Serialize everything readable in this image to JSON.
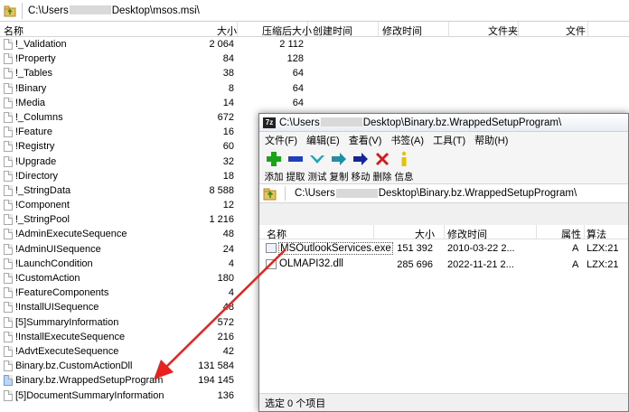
{
  "background_window": {
    "address_prefix": "C:\\Users",
    "address_suffix": "Desktop\\msos.msi\\",
    "columns": {
      "name": "名称",
      "size": "大小",
      "packed": "压缩后大小",
      "created": "创建时间",
      "modified": "修改时间",
      "folder": "文件夹",
      "file": "文件"
    },
    "rows": [
      {
        "name": "!_Validation",
        "size": "2 064",
        "packed": "2 112"
      },
      {
        "name": "!Property",
        "size": "84",
        "packed": "128"
      },
      {
        "name": "!_Tables",
        "size": "38",
        "packed": "64"
      },
      {
        "name": "!Binary",
        "size": "8",
        "packed": "64"
      },
      {
        "name": "!Media",
        "size": "14",
        "packed": "64"
      },
      {
        "name": "!_Columns",
        "size": "672",
        "packed": ""
      },
      {
        "name": "!Feature",
        "size": "16",
        "packed": ""
      },
      {
        "name": "!Registry",
        "size": "60",
        "packed": ""
      },
      {
        "name": "!Upgrade",
        "size": "32",
        "packed": ""
      },
      {
        "name": "!Directory",
        "size": "18",
        "packed": ""
      },
      {
        "name": "!_StringData",
        "size": "8 588",
        "packed": ""
      },
      {
        "name": "!Component",
        "size": "12",
        "packed": ""
      },
      {
        "name": "!_StringPool",
        "size": "1 216",
        "packed": ""
      },
      {
        "name": "!AdminExecuteSequence",
        "size": "48",
        "packed": ""
      },
      {
        "name": "!AdminUISequence",
        "size": "24",
        "packed": ""
      },
      {
        "name": "!LaunchCondition",
        "size": "4",
        "packed": ""
      },
      {
        "name": "!CustomAction",
        "size": "180",
        "packed": ""
      },
      {
        "name": "!FeatureComponents",
        "size": "4",
        "packed": ""
      },
      {
        "name": "!InstallUISequence",
        "size": "48",
        "packed": ""
      },
      {
        "name": "[5]SummaryInformation",
        "size": "572",
        "packed": ""
      },
      {
        "name": "!InstallExecuteSequence",
        "size": "216",
        "packed": ""
      },
      {
        "name": "!AdvtExecuteSequence",
        "size": "42",
        "packed": ""
      },
      {
        "name": "Binary.bz.CustomActionDll",
        "size": "131 584",
        "packed": ""
      },
      {
        "name": "Binary.bz.WrappedSetupProgram",
        "size": "194 145",
        "packed": ""
      },
      {
        "name": "[5]DocumentSummaryInformation",
        "size": "136",
        "packed": ""
      }
    ]
  },
  "foreground_window": {
    "title_prefix": "C:\\Users",
    "title_suffix": "Desktop\\Binary.bz.WrappedSetupProgram\\",
    "logo": "7z",
    "menu": [
      "文件(F)",
      "编辑(E)",
      "查看(V)",
      "书签(A)",
      "工具(T)",
      "帮助(H)"
    ],
    "toolbar": [
      {
        "label": "添加",
        "icon": "plus-icon",
        "color": "#1aa31a"
      },
      {
        "label": "提取",
        "icon": "minus-icon",
        "color": "#1f3fbf"
      },
      {
        "label": "测试",
        "icon": "check-icon",
        "color": "#1fa6b8"
      },
      {
        "label": "复制",
        "icon": "double-arrow-icon",
        "color": "#1f8fa6"
      },
      {
        "label": "移动",
        "icon": "arrow-right-icon",
        "color": "#16269a"
      },
      {
        "label": "删除",
        "icon": "x-icon",
        "color": "#d41a1a"
      },
      {
        "label": "信息",
        "icon": "info-icon",
        "color": "#e8c100"
      }
    ],
    "address_prefix": "C:\\Users",
    "address_suffix": "Desktop\\Binary.bz.WrappedSetupProgram\\",
    "columns": {
      "name": "名称",
      "size": "大小",
      "modified": "修改时间",
      "attr": "属性",
      "method": "算法"
    },
    "rows": [
      {
        "name": "MSOutlookServices.exe",
        "size": "151 392",
        "modified": "2010-03-22 2...",
        "attr": "A",
        "method": "LZX:21"
      },
      {
        "name": "OLMAPI32.dll",
        "size": "285 696",
        "modified": "2022-11-21 2...",
        "attr": "A",
        "method": "LZX:21"
      }
    ],
    "status": "选定 0 个项目"
  },
  "accent_color": "#e8201e"
}
